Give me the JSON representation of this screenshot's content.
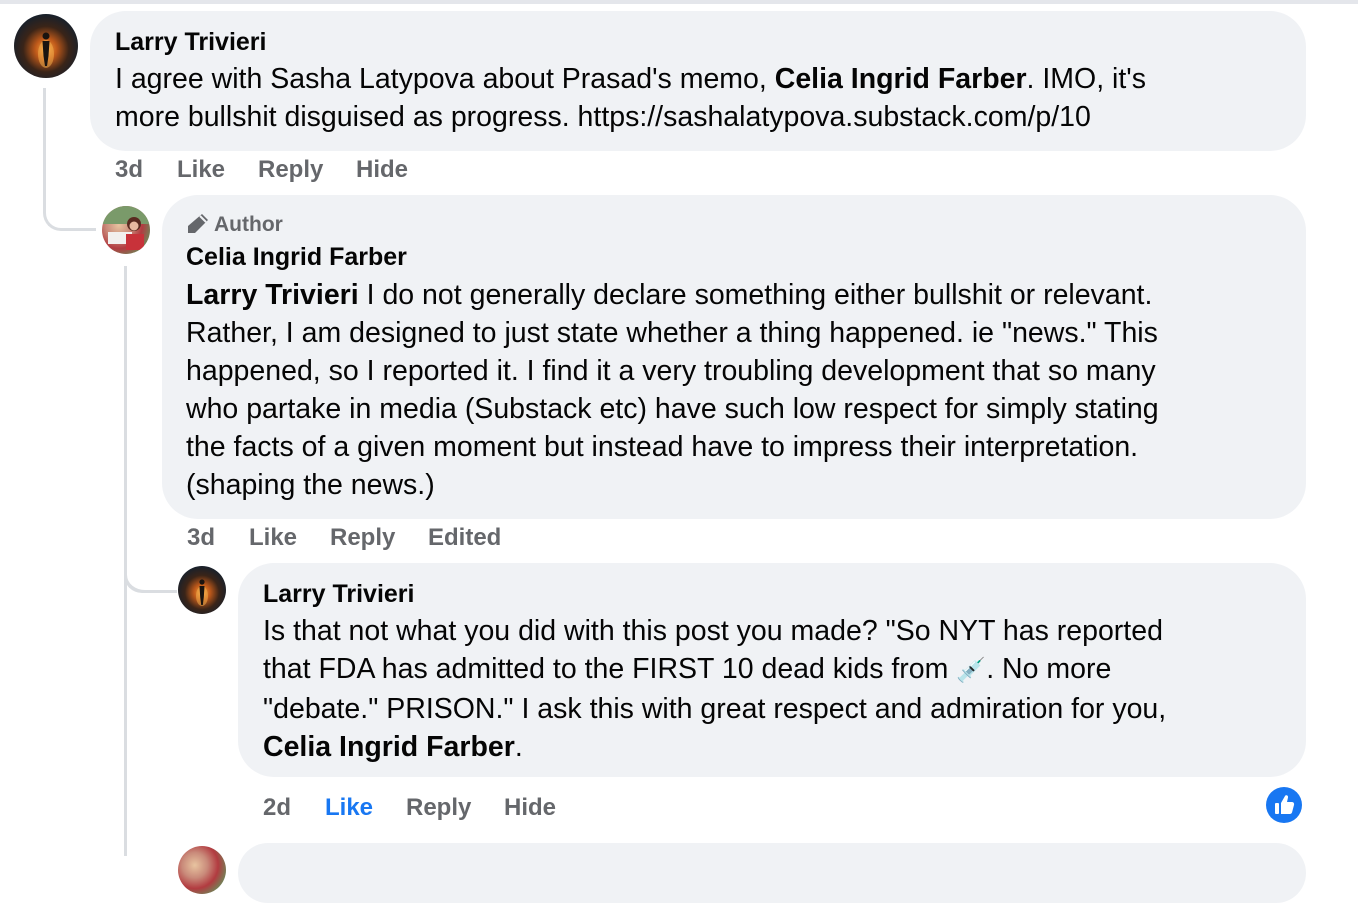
{
  "comments": [
    {
      "author": "Larry Trivieri",
      "text_before": "I agree with Sasha Latypova about Prasad's memo, ",
      "mention": "Celia Ingrid Farber",
      "text_after_line1": ". IMO, it's",
      "text_line2": "more bullshit disguised as progress. https://sashalatypova.substack.com/p/10",
      "time": "3d",
      "like_label": "Like",
      "reply_label": "Reply",
      "extra_label": "Hide",
      "avatar_icon": "person-glow-avatar"
    },
    {
      "badge": "Author",
      "badge_icon": "pen-icon",
      "author": "Celia Ingrid Farber",
      "mention": "Larry Trivieri",
      "lines": [
        " I do not generally declare something either bullshit or relevant.",
        "Rather, I am designed to just state whether a thing happened. ie \"news.\" This",
        "happened, so I reported it. I find it a very troubling development that so many",
        "who partake in media (Substack etc) have such low respect for simply stating",
        "the facts of a given moment but instead have to impress their interpretation.",
        "(shaping the news.)"
      ],
      "time": "3d",
      "like_label": "Like",
      "reply_label": "Reply",
      "extra_label": "Edited",
      "avatar_icon": "photo-avatar"
    },
    {
      "author": "Larry Trivieri",
      "line1": "Is that not what you did with this post you made? \"So NYT has reported",
      "line2_before": "that FDA has admitted to the FIRST 10 dead kids from ",
      "line2_emoji": "💉",
      "line2_after": ". No more",
      "line3": "\"debate.\" PRISON.\" I ask this with great respect and admiration for you,",
      "mention": "Celia Ingrid Farber",
      "mention_after": ".",
      "time": "2d",
      "like_label": "Like",
      "reply_label": "Reply",
      "extra_label": "Hide",
      "reaction_icon": "thumbs-up-icon",
      "like_active_color": "#1877f2"
    }
  ]
}
